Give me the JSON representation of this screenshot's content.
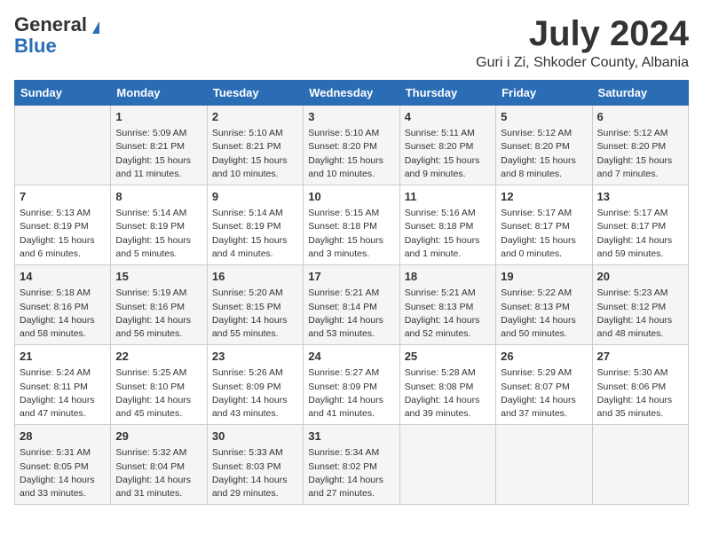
{
  "logo": {
    "general": "General",
    "blue": "Blue"
  },
  "title": {
    "month": "July 2024",
    "location": "Guri i Zi, Shkoder County, Albania"
  },
  "days_of_week": [
    "Sunday",
    "Monday",
    "Tuesday",
    "Wednesday",
    "Thursday",
    "Friday",
    "Saturday"
  ],
  "weeks": [
    [
      {
        "day": "",
        "sunrise": "",
        "sunset": "",
        "daylight": ""
      },
      {
        "day": "1",
        "sunrise": "Sunrise: 5:09 AM",
        "sunset": "Sunset: 8:21 PM",
        "daylight": "Daylight: 15 hours and 11 minutes."
      },
      {
        "day": "2",
        "sunrise": "Sunrise: 5:10 AM",
        "sunset": "Sunset: 8:21 PM",
        "daylight": "Daylight: 15 hours and 10 minutes."
      },
      {
        "day": "3",
        "sunrise": "Sunrise: 5:10 AM",
        "sunset": "Sunset: 8:20 PM",
        "daylight": "Daylight: 15 hours and 10 minutes."
      },
      {
        "day": "4",
        "sunrise": "Sunrise: 5:11 AM",
        "sunset": "Sunset: 8:20 PM",
        "daylight": "Daylight: 15 hours and 9 minutes."
      },
      {
        "day": "5",
        "sunrise": "Sunrise: 5:12 AM",
        "sunset": "Sunset: 8:20 PM",
        "daylight": "Daylight: 15 hours and 8 minutes."
      },
      {
        "day": "6",
        "sunrise": "Sunrise: 5:12 AM",
        "sunset": "Sunset: 8:20 PM",
        "daylight": "Daylight: 15 hours and 7 minutes."
      }
    ],
    [
      {
        "day": "7",
        "sunrise": "Sunrise: 5:13 AM",
        "sunset": "Sunset: 8:19 PM",
        "daylight": "Daylight: 15 hours and 6 minutes."
      },
      {
        "day": "8",
        "sunrise": "Sunrise: 5:14 AM",
        "sunset": "Sunset: 8:19 PM",
        "daylight": "Daylight: 15 hours and 5 minutes."
      },
      {
        "day": "9",
        "sunrise": "Sunrise: 5:14 AM",
        "sunset": "Sunset: 8:19 PM",
        "daylight": "Daylight: 15 hours and 4 minutes."
      },
      {
        "day": "10",
        "sunrise": "Sunrise: 5:15 AM",
        "sunset": "Sunset: 8:18 PM",
        "daylight": "Daylight: 15 hours and 3 minutes."
      },
      {
        "day": "11",
        "sunrise": "Sunrise: 5:16 AM",
        "sunset": "Sunset: 8:18 PM",
        "daylight": "Daylight: 15 hours and 1 minute."
      },
      {
        "day": "12",
        "sunrise": "Sunrise: 5:17 AM",
        "sunset": "Sunset: 8:17 PM",
        "daylight": "Daylight: 15 hours and 0 minutes."
      },
      {
        "day": "13",
        "sunrise": "Sunrise: 5:17 AM",
        "sunset": "Sunset: 8:17 PM",
        "daylight": "Daylight: 14 hours and 59 minutes."
      }
    ],
    [
      {
        "day": "14",
        "sunrise": "Sunrise: 5:18 AM",
        "sunset": "Sunset: 8:16 PM",
        "daylight": "Daylight: 14 hours and 58 minutes."
      },
      {
        "day": "15",
        "sunrise": "Sunrise: 5:19 AM",
        "sunset": "Sunset: 8:16 PM",
        "daylight": "Daylight: 14 hours and 56 minutes."
      },
      {
        "day": "16",
        "sunrise": "Sunrise: 5:20 AM",
        "sunset": "Sunset: 8:15 PM",
        "daylight": "Daylight: 14 hours and 55 minutes."
      },
      {
        "day": "17",
        "sunrise": "Sunrise: 5:21 AM",
        "sunset": "Sunset: 8:14 PM",
        "daylight": "Daylight: 14 hours and 53 minutes."
      },
      {
        "day": "18",
        "sunrise": "Sunrise: 5:21 AM",
        "sunset": "Sunset: 8:13 PM",
        "daylight": "Daylight: 14 hours and 52 minutes."
      },
      {
        "day": "19",
        "sunrise": "Sunrise: 5:22 AM",
        "sunset": "Sunset: 8:13 PM",
        "daylight": "Daylight: 14 hours and 50 minutes."
      },
      {
        "day": "20",
        "sunrise": "Sunrise: 5:23 AM",
        "sunset": "Sunset: 8:12 PM",
        "daylight": "Daylight: 14 hours and 48 minutes."
      }
    ],
    [
      {
        "day": "21",
        "sunrise": "Sunrise: 5:24 AM",
        "sunset": "Sunset: 8:11 PM",
        "daylight": "Daylight: 14 hours and 47 minutes."
      },
      {
        "day": "22",
        "sunrise": "Sunrise: 5:25 AM",
        "sunset": "Sunset: 8:10 PM",
        "daylight": "Daylight: 14 hours and 45 minutes."
      },
      {
        "day": "23",
        "sunrise": "Sunrise: 5:26 AM",
        "sunset": "Sunset: 8:09 PM",
        "daylight": "Daylight: 14 hours and 43 minutes."
      },
      {
        "day": "24",
        "sunrise": "Sunrise: 5:27 AM",
        "sunset": "Sunset: 8:09 PM",
        "daylight": "Daylight: 14 hours and 41 minutes."
      },
      {
        "day": "25",
        "sunrise": "Sunrise: 5:28 AM",
        "sunset": "Sunset: 8:08 PM",
        "daylight": "Daylight: 14 hours and 39 minutes."
      },
      {
        "day": "26",
        "sunrise": "Sunrise: 5:29 AM",
        "sunset": "Sunset: 8:07 PM",
        "daylight": "Daylight: 14 hours and 37 minutes."
      },
      {
        "day": "27",
        "sunrise": "Sunrise: 5:30 AM",
        "sunset": "Sunset: 8:06 PM",
        "daylight": "Daylight: 14 hours and 35 minutes."
      }
    ],
    [
      {
        "day": "28",
        "sunrise": "Sunrise: 5:31 AM",
        "sunset": "Sunset: 8:05 PM",
        "daylight": "Daylight: 14 hours and 33 minutes."
      },
      {
        "day": "29",
        "sunrise": "Sunrise: 5:32 AM",
        "sunset": "Sunset: 8:04 PM",
        "daylight": "Daylight: 14 hours and 31 minutes."
      },
      {
        "day": "30",
        "sunrise": "Sunrise: 5:33 AM",
        "sunset": "Sunset: 8:03 PM",
        "daylight": "Daylight: 14 hours and 29 minutes."
      },
      {
        "day": "31",
        "sunrise": "Sunrise: 5:34 AM",
        "sunset": "Sunset: 8:02 PM",
        "daylight": "Daylight: 14 hours and 27 minutes."
      },
      {
        "day": "",
        "sunrise": "",
        "sunset": "",
        "daylight": ""
      },
      {
        "day": "",
        "sunrise": "",
        "sunset": "",
        "daylight": ""
      },
      {
        "day": "",
        "sunrise": "",
        "sunset": "",
        "daylight": ""
      }
    ]
  ]
}
